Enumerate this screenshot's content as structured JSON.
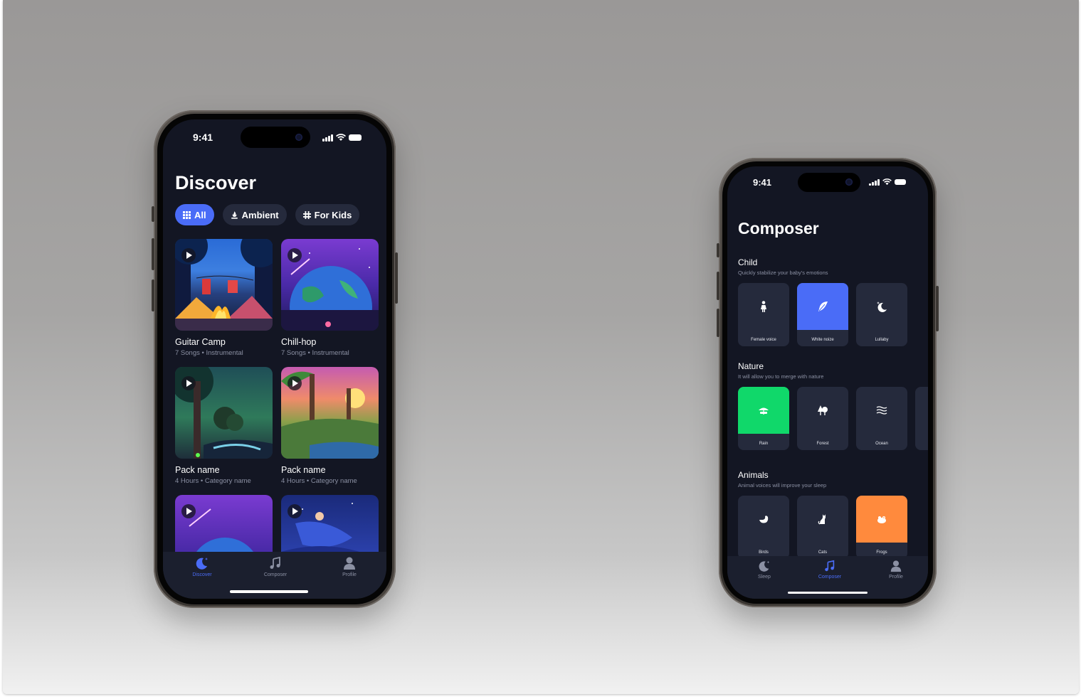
{
  "phone1": {
    "status": {
      "time": "9:41"
    },
    "title": "Discover",
    "chips": [
      {
        "label": "All",
        "icon": "grid-icon",
        "active": true
      },
      {
        "label": "Ambient",
        "icon": "campfire-icon",
        "active": false
      },
      {
        "label": "For Kids",
        "icon": "kids-icon",
        "active": false
      }
    ],
    "cards": [
      {
        "name": "Guitar Camp",
        "duration": "7 Songs",
        "category": "Instrumental"
      },
      {
        "name": "Chill-hop",
        "duration": "7 Songs",
        "category": "Instrumental"
      },
      {
        "name": "Pack name",
        "duration": "4 Hours",
        "category": "Category name"
      },
      {
        "name": "Pack name",
        "duration": "4 Hours",
        "category": "Category name"
      }
    ],
    "tabs": [
      {
        "label": "Discover",
        "icon": "moon-icon",
        "active": true
      },
      {
        "label": "Composer",
        "icon": "music-note-icon",
        "active": false
      },
      {
        "label": "Profile",
        "icon": "person-icon",
        "active": false
      }
    ]
  },
  "phone2": {
    "status": {
      "time": "9:41"
    },
    "title": "Composer",
    "sections": {
      "child": {
        "title": "Child",
        "subtitle": "Quickly stabilize your baby's emotions",
        "tiles": [
          {
            "label": "Female voice",
            "icon": "woman-icon",
            "color": "#252a3c"
          },
          {
            "label": "White noize",
            "icon": "feather-icon",
            "color": "#4a6cf7"
          },
          {
            "label": "Lullaby",
            "icon": "moon-stars-icon",
            "color": "#252a3c"
          }
        ]
      },
      "nature": {
        "title": "Nature",
        "subtitle": "It will allow you to merge with nature",
        "tiles": [
          {
            "label": "Rain",
            "icon": "rain-icon",
            "color": "#10d86a"
          },
          {
            "label": "Forest",
            "icon": "trees-icon",
            "color": "#252a3c"
          },
          {
            "label": "Ocean",
            "icon": "waves-icon",
            "color": "#252a3c"
          }
        ]
      },
      "animals": {
        "title": "Animals",
        "subtitle": "Animal voices will improve your sleep",
        "tiles": [
          {
            "label": "Birds",
            "icon": "bird-icon",
            "color": "#252a3c"
          },
          {
            "label": "Cats",
            "icon": "cat-icon",
            "color": "#252a3c"
          },
          {
            "label": "Frogs",
            "icon": "frog-icon",
            "color": "#ff8a3d"
          }
        ]
      }
    },
    "tabs": [
      {
        "label": "Sleep",
        "icon": "moon-icon",
        "active": false
      },
      {
        "label": "Composer",
        "icon": "music-note-icon",
        "active": true
      },
      {
        "label": "Profile",
        "icon": "person-icon",
        "active": false
      }
    ]
  }
}
